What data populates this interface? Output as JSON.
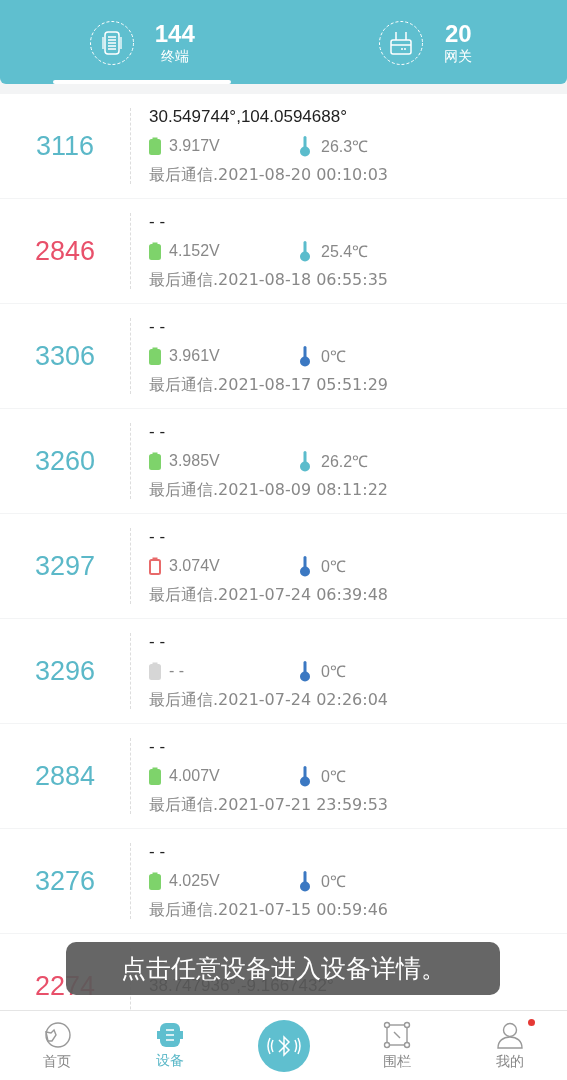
{
  "header": {
    "tabs": [
      {
        "kind": "terminal",
        "count": "144",
        "label": "终端",
        "selected": true
      },
      {
        "kind": "gateway",
        "count": "20",
        "label": "网关",
        "selected": false
      }
    ]
  },
  "devices": [
    {
      "id": "3116",
      "alert": false,
      "location": "30.549744°,104.0594688°",
      "battery": {
        "kind": "filled",
        "color": "#7ed36b"
      },
      "voltage": "3.917V",
      "thermometer": {
        "color": "#5bbccc"
      },
      "temperature": "26.3℃",
      "last_contact": "最后通信.2021-08-20 00:10:03"
    },
    {
      "id": "2846",
      "alert": true,
      "location": "- -",
      "battery": {
        "kind": "filled",
        "color": "#7ed36b"
      },
      "voltage": "4.152V",
      "thermometer": {
        "color": "#5bbccc"
      },
      "temperature": "25.4℃",
      "last_contact": "最后通信.2021-08-18 06:55:35"
    },
    {
      "id": "3306",
      "alert": false,
      "location": "- -",
      "battery": {
        "kind": "filled",
        "color": "#7ed36b"
      },
      "voltage": "3.961V",
      "thermometer": {
        "color": "#3b78c2"
      },
      "temperature": "0℃",
      "last_contact": "最后通信.2021-08-17 05:51:29"
    },
    {
      "id": "3260",
      "alert": false,
      "location": "- -",
      "battery": {
        "kind": "filled",
        "color": "#7ed36b"
      },
      "voltage": "3.985V",
      "thermometer": {
        "color": "#5bbccc"
      },
      "temperature": "26.2℃",
      "last_contact": "最后通信.2021-08-09 08:11:22"
    },
    {
      "id": "3297",
      "alert": false,
      "location": "- -",
      "battery": {
        "kind": "outline",
        "color": "#e86a6a"
      },
      "voltage": "3.074V",
      "thermometer": {
        "color": "#3b78c2"
      },
      "temperature": "0℃",
      "last_contact": "最后通信.2021-07-24 06:39:48"
    },
    {
      "id": "3296",
      "alert": false,
      "location": "- -",
      "battery": {
        "kind": "filled",
        "color": "#d6d6d6"
      },
      "voltage": "- -",
      "thermometer": {
        "color": "#3b78c2"
      },
      "temperature": "0℃",
      "last_contact": "最后通信.2021-07-24 02:26:04"
    },
    {
      "id": "2884",
      "alert": false,
      "location": "- -",
      "battery": {
        "kind": "filled",
        "color": "#7ed36b"
      },
      "voltage": "4.007V",
      "thermometer": {
        "color": "#3b78c2"
      },
      "temperature": "0℃",
      "last_contact": "最后通信.2021-07-21 23:59:53"
    },
    {
      "id": "3276",
      "alert": false,
      "location": "- -",
      "battery": {
        "kind": "filled",
        "color": "#7ed36b"
      },
      "voltage": "4.025V",
      "thermometer": {
        "color": "#3b78c2"
      },
      "temperature": "0℃",
      "last_contact": "最后通信.2021-07-15 00:59:46"
    },
    {
      "id": "2274",
      "alert": true,
      "location": "38.747936°,-9.1667432°"
    }
  ],
  "toast": "点击任意设备进入设备详情。",
  "nav": [
    {
      "kind": "home",
      "label": "首页",
      "selected": false,
      "badge": false
    },
    {
      "kind": "device",
      "label": "设备",
      "selected": true,
      "badge": false
    },
    {
      "kind": "bluetooth"
    },
    {
      "kind": "fence",
      "label": "围栏",
      "selected": false,
      "badge": false
    },
    {
      "kind": "me",
      "label": "我的",
      "selected": false,
      "badge": true
    }
  ]
}
